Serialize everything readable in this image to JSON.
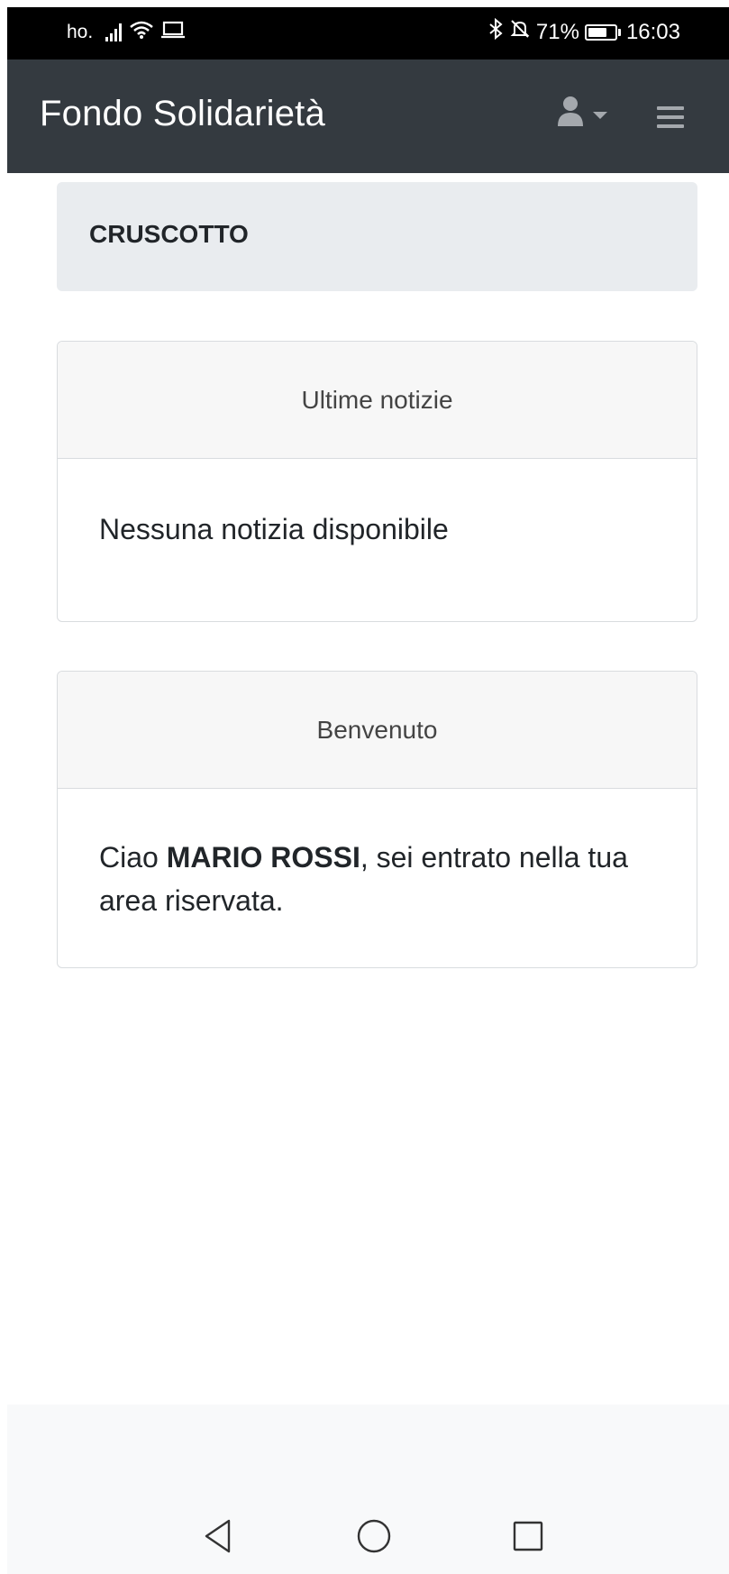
{
  "status_bar": {
    "carrier": "ho.",
    "battery_percent": "71%",
    "battery_level": 0.71,
    "time": "16:03",
    "icons": [
      "signal-icon",
      "wifi-icon",
      "laptop-icon",
      "bluetooth-icon",
      "mute-icon",
      "battery-icon"
    ]
  },
  "navbar": {
    "brand": "Fondo Solidarietà",
    "icons": [
      "user-icon",
      "caret-down-icon",
      "hamburger-menu-icon"
    ]
  },
  "breadcrumb": {
    "title": "CRUSCOTTO"
  },
  "cards": {
    "news": {
      "header": "Ultime notizie",
      "body": "Nessuna notizia disponibile"
    },
    "welcome": {
      "header": "Benvenuto",
      "greeting": "Ciao ",
      "user_name": "MARIO ROSSI",
      "message": ", sei entrato nella tua area riservata."
    }
  },
  "android_nav": {
    "icons": [
      "back-icon",
      "home-icon",
      "recent-apps-icon"
    ]
  },
  "colors": {
    "navbar_bg": "#343a40",
    "breadcrumb_bg": "#e9ecef",
    "card_header_bg": "#f7f7f7",
    "footer_bg": "#f8f9fa",
    "text": "#212529"
  }
}
